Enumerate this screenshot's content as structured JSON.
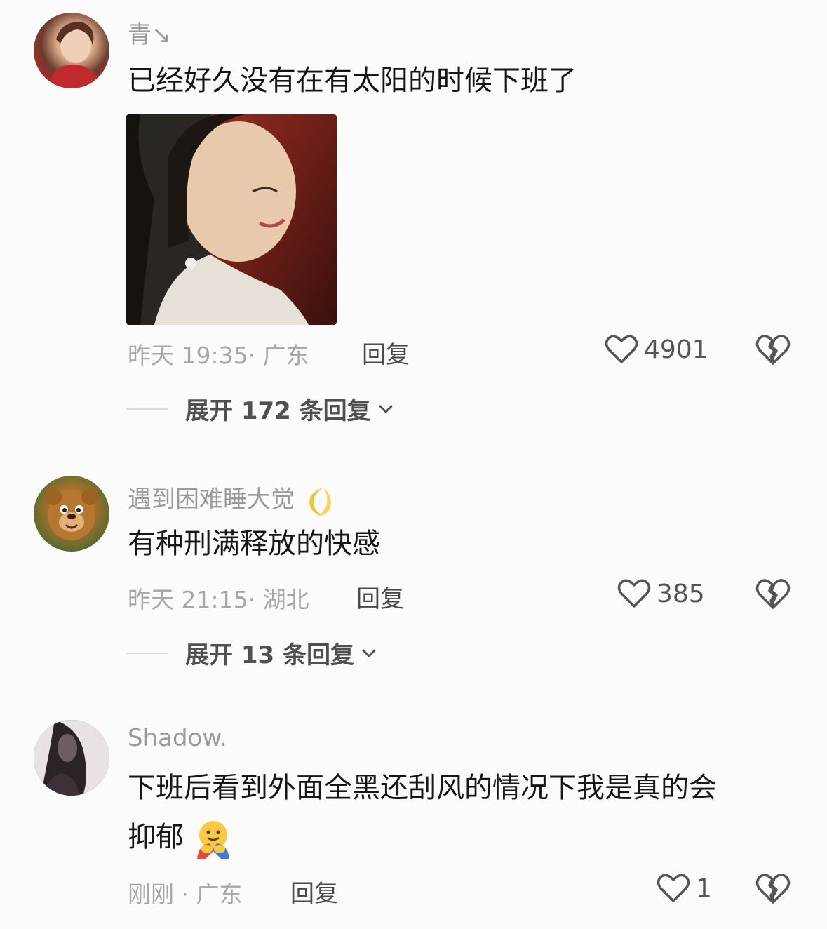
{
  "comments": [
    {
      "username": "青↘",
      "text": "已经好久没有在有太阳的时候下班了",
      "has_image": true,
      "time_location": "昨天 19:35· 广东",
      "reply_label": "回复",
      "likes": "4901",
      "expand_label": "展开 172 条回复"
    },
    {
      "username": "遇到困难睡大觉",
      "username_emoji": "moon-emoji",
      "text": "有种刑满释放的快感",
      "time_location": "昨天 21:15· 湖北",
      "reply_label": "回复",
      "likes": "385",
      "expand_label": "展开 13 条回复"
    },
    {
      "username": "Shadow.",
      "text": "下班后看到外面全黑还刮风的情况下我是真的会",
      "text_line2": "抑郁",
      "text_emoji": "hug-emoji",
      "time_location": "刚刚 · 广东",
      "reply_label": "回复",
      "likes": "1"
    }
  ],
  "colors": {
    "background": "#fbfbfb",
    "username": "#9a9a9a",
    "meta": "#a7a7a7",
    "text": "#161616"
  },
  "icons": [
    "heart-outline-icon",
    "broken-heart-icon",
    "chevron-down-icon"
  ]
}
